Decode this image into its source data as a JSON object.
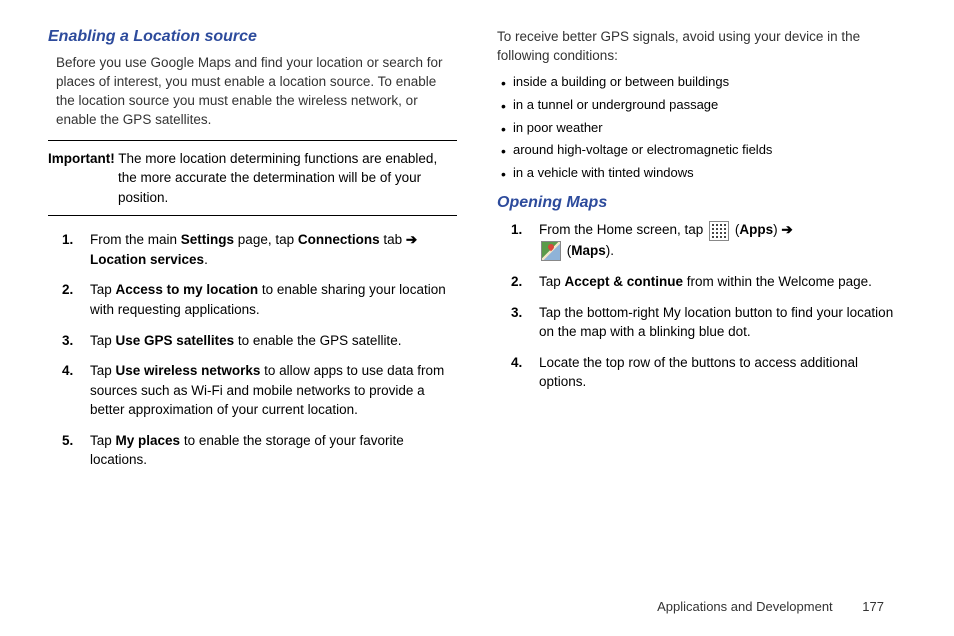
{
  "left": {
    "heading": "Enabling a Location source",
    "intro": "Before you use Google Maps and find your location or search for places of interest, you must enable a location source. To enable the location source you must enable the wireless network, or enable the GPS satellites.",
    "importantLabel": "Important!",
    "importantText": " The more location determining functions are enabled, the more accurate the determination will be of your position.",
    "steps": {
      "s1_a": "From the main ",
      "s1_b": "Settings",
      "s1_c": " page, tap ",
      "s1_d": "Connections",
      "s1_e": " tab ",
      "s1_arrow": "➔",
      "s1_f": "Location services",
      "s1_g": ".",
      "s2_a": "Tap ",
      "s2_b": "Access to my location",
      "s2_c": " to enable sharing your location with requesting applications.",
      "s3_a": "Tap ",
      "s3_b": "Use GPS satellites",
      "s3_c": " to enable the GPS satellite.",
      "s4_a": "Tap ",
      "s4_b": "Use wireless networks",
      "s4_c": " to allow apps to use data from sources such as Wi-Fi and mobile networks to provide a better approximation of your current location.",
      "s5_a": "Tap ",
      "s5_b": "My places",
      "s5_c": " to enable the storage of your favorite locations."
    }
  },
  "right": {
    "intro": "To receive better GPS signals, avoid using your device in the following conditions:",
    "bullets": {
      "b1": "inside a building or between buildings",
      "b2": "in a tunnel or underground passage",
      "b3": "in poor weather",
      "b4": "around high-voltage or electromagnetic fields",
      "b5": "in a vehicle with tinted windows"
    },
    "heading": "Opening Maps",
    "steps": {
      "s1_a": "From the Home screen, tap ",
      "s1_b": " (",
      "s1_c": "Apps",
      "s1_d": ") ",
      "s1_arrow": "➔",
      "s1_e": " (",
      "s1_f": "Maps",
      "s1_g": ").",
      "s2_a": "Tap ",
      "s2_b": "Accept & continue",
      "s2_c": " from within the Welcome page.",
      "s3": "Tap the bottom-right My location button to find your location on the map with a blinking blue dot.",
      "s4": "Locate the top row of the buttons to access additional options."
    }
  },
  "footer": {
    "section": "Applications and Development",
    "page": "177"
  }
}
